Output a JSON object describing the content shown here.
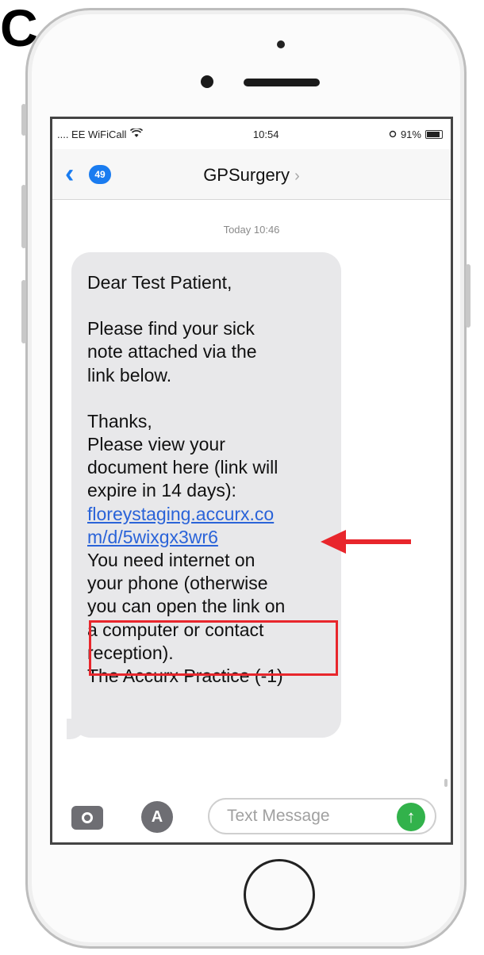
{
  "panel_label": "C",
  "status_bar": {
    "carrier": ".... EE WiFiCall",
    "wifi_icon": "wifi-icon",
    "time": "10:54",
    "location_icon": "location-icon",
    "battery_percent": "91%",
    "battery_level": 0.91
  },
  "nav": {
    "back_icon": "chevron-left-icon",
    "back_badge": "49",
    "contact_name": "GPSurgery",
    "contact_chevron": "›"
  },
  "conversation": {
    "timestamp": "Today 10:46",
    "message": {
      "greeting": "Dear Test Patient,",
      "body_lines": [
        "Please find your sick",
        "note attached via the",
        "link below."
      ],
      "signoff_lines": [
        "Thanks,",
        "Please view your",
        "document here (link will",
        "expire in 14 days):"
      ],
      "link_lines": [
        "floreystaging.accurx.co",
        "m/d/5wixgx3wr6"
      ],
      "closing_lines": [
        "You need internet on",
        "your phone (otherwise",
        "you can open the link on",
        "a computer or contact",
        "reception).",
        "The Accurx Practice (-1)"
      ]
    }
  },
  "annotation": {
    "highlight_color": "#e8262c",
    "arrow_icon": "left-arrow-icon"
  },
  "input_bar": {
    "camera_icon": "camera-icon",
    "apps_icon": "app-store-icon",
    "apps_glyph": "A",
    "placeholder": "Text Message",
    "send_icon": "send-arrow-icon",
    "send_glyph": "↑"
  },
  "colors": {
    "ios_blue": "#1a7cf0",
    "bubble_gray": "#e8e8ea",
    "send_green": "#32b24b",
    "link_blue": "#2a63d8"
  }
}
